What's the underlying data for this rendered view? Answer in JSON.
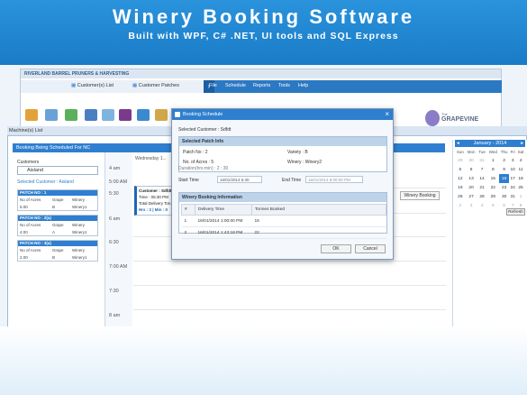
{
  "banner": {
    "title": "Winery Booking Software",
    "subtitle": "Built with WPF, C# .NET, UI tools and SQL Express"
  },
  "back_window": {
    "title": "RIVERLAND BARREL PRUNERS & HARVESTING",
    "nav_items": [
      "Customer(s) List",
      "Customer Patches"
    ],
    "menu": [
      "File",
      "Schedule",
      "Reports",
      "Tools",
      "Help"
    ],
    "logo_text": "GRAPEVINE",
    "logo_small": "The"
  },
  "machines_window": {
    "title": "Machine(s) List",
    "tab_header": "Booking Being Scheduled For NC",
    "customers_label": "Customers",
    "customer_value": "Aisland",
    "selected_customer": "Selected Customer : Aisland",
    "patches": [
      {
        "header": "PATCH NO : 1",
        "col1": "No of Acres",
        "col2": "Grape",
        "col3": "Winery",
        "v1": "5.00",
        "v2": "B",
        "v3": "Winery1"
      },
      {
        "header": "PATCH NO : 2(a)",
        "col1": "No of Acres",
        "col2": "Grape",
        "col3": "Winery",
        "v1": "4.00",
        "v2": "A",
        "v3": "Winery1"
      },
      {
        "header": "PATCH NO : 3(a)",
        "col1": "No of Acres",
        "col2": "Grape",
        "col3": "Winery",
        "v1": "2.00",
        "v2": "B",
        "v3": "Winery1"
      }
    ],
    "times": [
      "4 am",
      "5:00 AM",
      "5:30",
      "6 am",
      "6:30",
      "7:00 AM",
      "7:30",
      "8 am"
    ],
    "day_header": "Wednesday 1...",
    "event": {
      "line1": "Customer : Sdfdt",
      "line2": "Time : 05:30 PM",
      "line3": "Total Delivery Ton...",
      "line4": "Hrs : 2 | Min : 0"
    },
    "winery_booking_button": "Winery Booking",
    "refresh_button": "Refresh"
  },
  "calendar": {
    "header": "January - 2014",
    "days": [
      "Sun",
      "Mon",
      "Tue",
      "Wed",
      "Thu",
      "Fri",
      "Sat"
    ],
    "weeks": [
      [
        "29",
        "30",
        "31",
        "1",
        "2",
        "3",
        "4"
      ],
      [
        "5",
        "6",
        "7",
        "8",
        "9",
        "10",
        "11"
      ],
      [
        "12",
        "13",
        "14",
        "15",
        "16",
        "17",
        "18"
      ],
      [
        "19",
        "20",
        "21",
        "22",
        "23",
        "24",
        "25"
      ],
      [
        "26",
        "27",
        "28",
        "29",
        "30",
        "31",
        "1"
      ],
      [
        "2",
        "3",
        "4",
        "5",
        "6",
        "7",
        "8"
      ]
    ],
    "selected": "16"
  },
  "dialog": {
    "title": "Booking Schedule",
    "selected_customer": "Selected Customer : Sdfdt",
    "patch_info_header": "Selected Patch Info",
    "patch_no": "Patch No : 2",
    "variety": "Variety : B",
    "acres": "No. of Acres : 5",
    "winery": "Winery : Winery2",
    "duration_label": "Duration(hrs:min) : 2 : 30",
    "start_time_label": "Start Time",
    "start_time_value": "16/01/2014 5:30",
    "end_time_label": "End Time",
    "end_time_value": "16/01/2014 8:00:00 PM",
    "winery_info_header": "Winery Booking Information",
    "table_headers": [
      "#",
      "Delivery Time",
      "Tonnes Booked"
    ],
    "table_rows": [
      [
        "1",
        "16/01/2014 1:00:00 PM",
        "15"
      ],
      [
        "2",
        "16/01/2014 1:43:18 PM",
        "22"
      ]
    ],
    "ok_button": "OK",
    "cancel_button": "Cancel"
  },
  "colors": {
    "banner_blue": "#1f86d0",
    "accent_blue": "#2e7fcf"
  }
}
